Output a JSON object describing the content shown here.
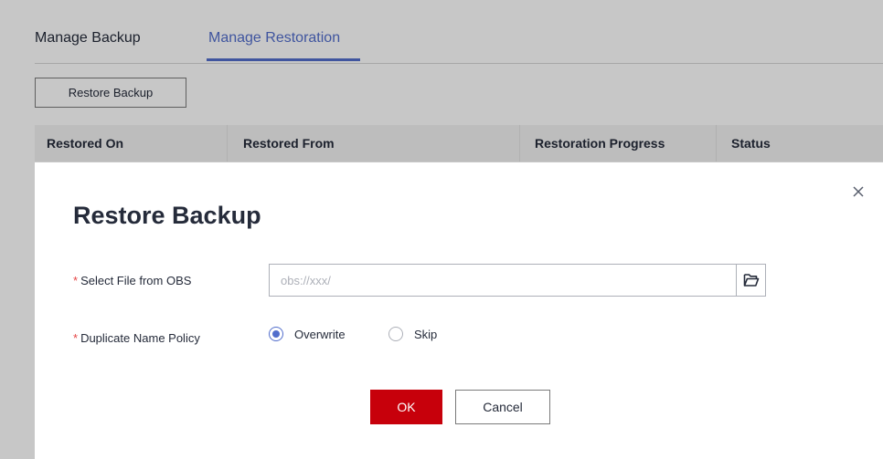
{
  "tabs": [
    {
      "label": "Manage Backup",
      "active": false
    },
    {
      "label": "Manage Restoration",
      "active": true
    }
  ],
  "toolbar": {
    "restore_label": "Restore Backup"
  },
  "table": {
    "headers": [
      "Restored On",
      "Restored From",
      "Restoration Progress",
      "Status"
    ]
  },
  "dialog": {
    "title": "Restore Backup",
    "file_field": {
      "required_mark": "*",
      "label": "Select File from OBS",
      "placeholder": "obs://xxx/",
      "value": ""
    },
    "policy_field": {
      "required_mark": "*",
      "label": "Duplicate Name Policy",
      "options": [
        "Overwrite",
        "Skip"
      ],
      "selected": "Overwrite"
    },
    "ok_label": "OK",
    "cancel_label": "Cancel",
    "icons": {
      "close": "close-icon",
      "folder": "folder-open-icon"
    }
  },
  "colors": {
    "accent": "#526ecc",
    "primary_button": "#c7000b",
    "required": "#e54545"
  }
}
